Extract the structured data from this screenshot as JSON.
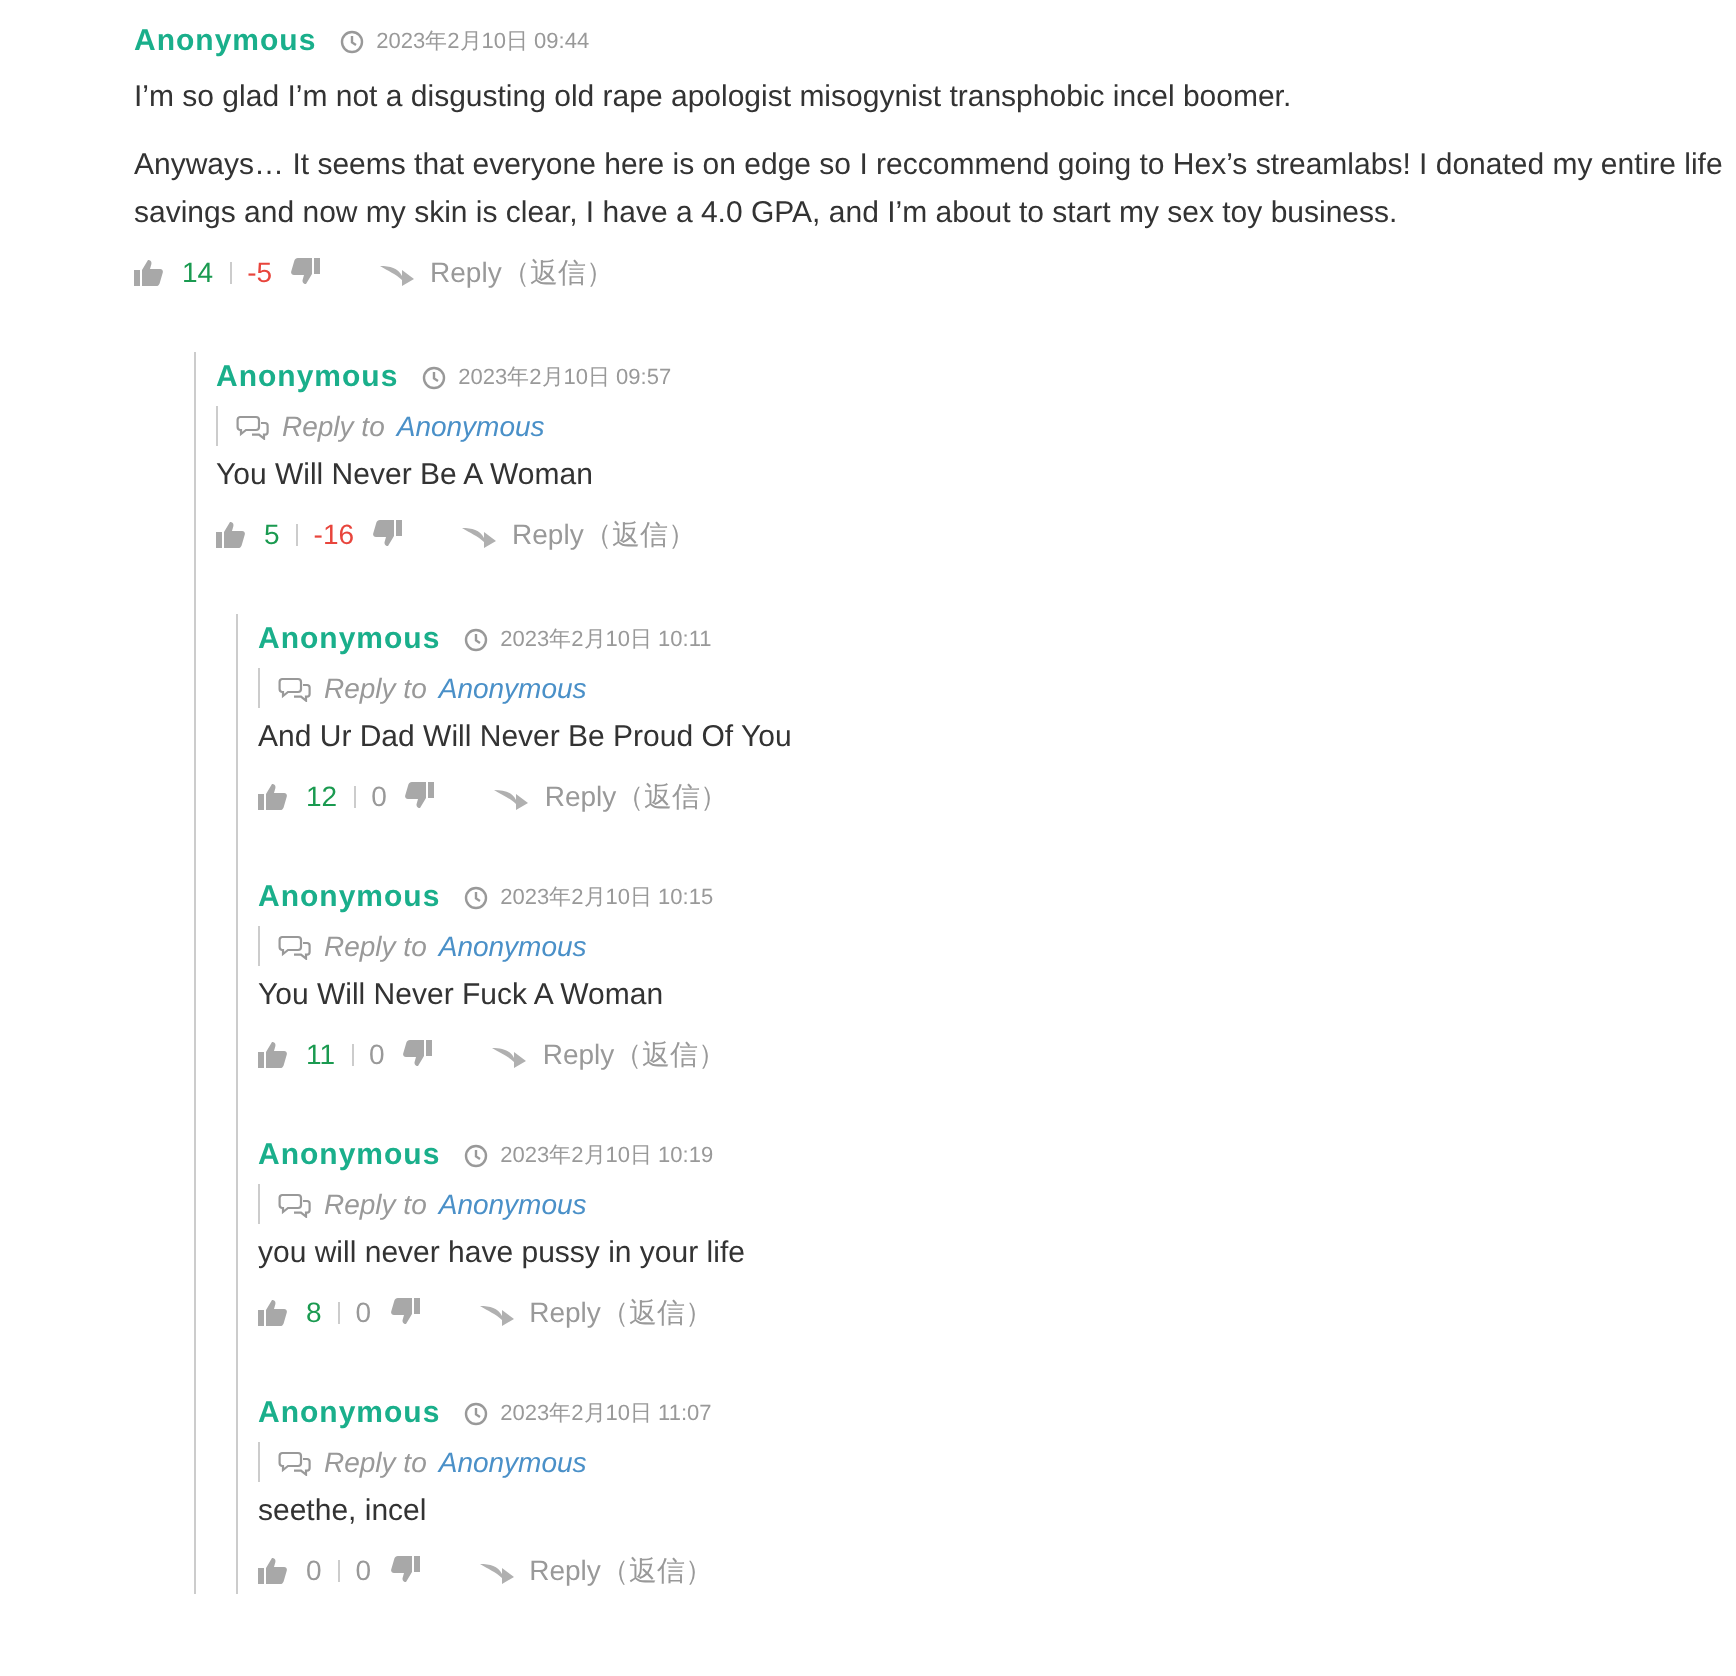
{
  "comments": [
    {
      "author": "Anonymous",
      "time": "2023年2月10日 09:44",
      "body": [
        "I’m so glad I’m not a disgusting old rape apologist misogynist transphobic incel boomer.",
        "Anyways… It seems that everyone here is on edge so I reccommend going to Hex’s streamlabs! I donated my entire life savings and now my skin is clear, I have a 4.0 GPA, and I’m about to start my sex toy business."
      ],
      "likes": {
        "count": "14",
        "highlighted": true
      },
      "dislikes": {
        "count": "-5",
        "highlighted": true
      },
      "reply": "Reply（返信）",
      "children": [
        {
          "author": "Anonymous",
          "time": "2023年2月10日 09:57",
          "reply_to": {
            "label": "Reply to",
            "name": "Anonymous"
          },
          "body": [
            "You Will Never Be A Woman"
          ],
          "likes": {
            "count": "5",
            "highlighted": true
          },
          "dislikes": {
            "count": "-16",
            "highlighted": true
          },
          "reply": "Reply（返信）",
          "children": [
            {
              "author": "Anonymous",
              "time": "2023年2月10日 10:11",
              "reply_to": {
                "label": "Reply to",
                "name": "Anonymous"
              },
              "body": [
                "And Ur Dad Will Never Be Proud Of You"
              ],
              "likes": {
                "count": "12",
                "highlighted": true
              },
              "dislikes": {
                "count": "0",
                "highlighted": false
              },
              "reply": "Reply（返信）"
            },
            {
              "author": "Anonymous",
              "time": "2023年2月10日 10:15",
              "reply_to": {
                "label": "Reply to",
                "name": "Anonymous"
              },
              "body": [
                "You Will Never Fuck A Woman"
              ],
              "likes": {
                "count": "11",
                "highlighted": true
              },
              "dislikes": {
                "count": "0",
                "highlighted": false
              },
              "reply": "Reply（返信）"
            },
            {
              "author": "Anonymous",
              "time": "2023年2月10日 10:19",
              "reply_to": {
                "label": "Reply to",
                "name": "Anonymous"
              },
              "body": [
                "you will never have pussy in your life"
              ],
              "likes": {
                "count": "8",
                "highlighted": true
              },
              "dislikes": {
                "count": "0",
                "highlighted": false
              },
              "reply": "Reply（返信）"
            },
            {
              "author": "Anonymous",
              "time": "2023年2月10日 11:07",
              "reply_to": {
                "label": "Reply to",
                "name": "Anonymous"
              },
              "body": [
                "seethe, incel"
              ],
              "likes": {
                "count": "0",
                "highlighted": false
              },
              "dislikes": {
                "count": "0",
                "highlighted": false
              },
              "reply": "Reply（返信）"
            }
          ]
        }
      ]
    }
  ]
}
